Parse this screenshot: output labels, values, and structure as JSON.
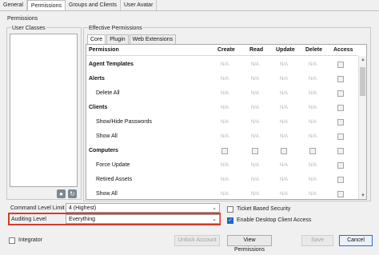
{
  "tabs": [
    "General",
    "Permissions",
    "Groups and Clients",
    "User Avatar"
  ],
  "permissions_group": "Permissions",
  "user_classes": "User Classes",
  "effective_permissions": "Effective Permissions",
  "subtabs": [
    "Core",
    "Plugin",
    "Web Extensions"
  ],
  "columns": {
    "permission": "Permission",
    "create": "Create",
    "read": "Read",
    "update": "Update",
    "delete": "Delete",
    "access": "Access"
  },
  "na": "N/A",
  "rows": [
    {
      "label": "Agent Templates",
      "type": "cat",
      "cells": [
        "na",
        "na",
        "na",
        "na",
        "cb"
      ]
    },
    {
      "label": "Alerts",
      "type": "cat",
      "cells": [
        "na",
        "na",
        "na",
        "na",
        "cb"
      ]
    },
    {
      "label": "Delete All",
      "type": "item",
      "cells": [
        "na",
        "na",
        "na",
        "na",
        "cb"
      ]
    },
    {
      "label": "Clients",
      "type": "cat",
      "cells": [
        "na",
        "na",
        "na",
        "na",
        "cb"
      ]
    },
    {
      "label": "Show/Hide Passwords",
      "type": "item",
      "cells": [
        "na",
        "na",
        "na",
        "na",
        "cb"
      ]
    },
    {
      "label": "Show All",
      "type": "item",
      "cells": [
        "na",
        "na",
        "na",
        "na",
        "cb"
      ]
    },
    {
      "label": "Computers",
      "type": "cat",
      "cells": [
        "cb",
        "cb",
        "cb",
        "cb",
        "cb"
      ]
    },
    {
      "label": "Force Update",
      "type": "item",
      "cells": [
        "na",
        "na",
        "na",
        "na",
        "cb"
      ]
    },
    {
      "label": "Retired Assets",
      "type": "item",
      "cells": [
        "na",
        "na",
        "na",
        "na",
        "cb"
      ]
    },
    {
      "label": "Show All",
      "type": "item",
      "cells": [
        "na",
        "na",
        "na",
        "na",
        "cb"
      ]
    }
  ],
  "command_level_label": "Command Level Limit",
  "command_level_value": "4 (Highest)",
  "auditing_label": "Auditing Level",
  "auditing_value": "Everything",
  "ticket_security": "Ticket Based Security",
  "desktop_access": "Enable Desktop Client Access",
  "integrator": "Integrator",
  "buttons": {
    "unlock": "Unlock Account",
    "view": "View Permissions",
    "save": "Save",
    "cancel": "Cancel"
  },
  "colors": {
    "highlight": "#d63b2a",
    "checkbox_on": "#1f64c9"
  }
}
